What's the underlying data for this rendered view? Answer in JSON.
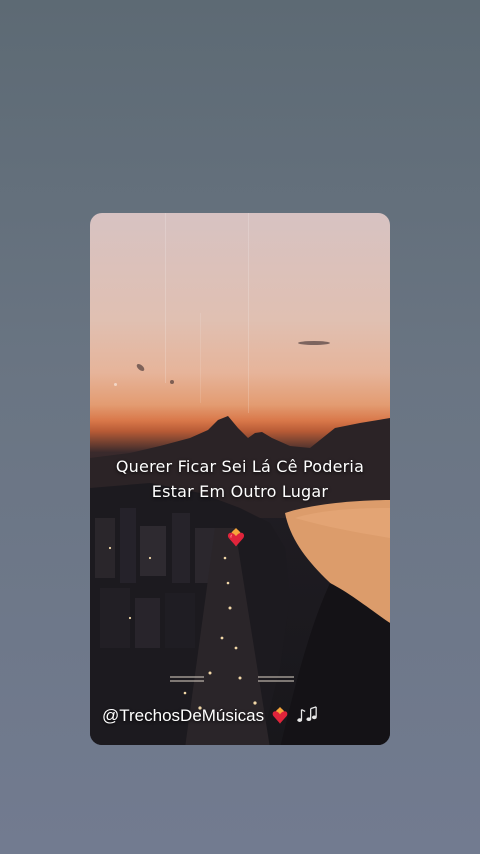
{
  "story": {
    "lyrics": {
      "line1": "Querer Ficar Sei Lá Cê Poderia",
      "line2": "Estar Em Outro Lugar"
    },
    "handle": "@TrechosDeMúsicas",
    "icons": {
      "center": "heart-on-fire-icon",
      "handle_heart": "heart-on-fire-icon",
      "notes": "musical-notes-icon"
    }
  },
  "colors": {
    "background_top": "#5d6a74",
    "background_bottom": "#727b90",
    "sky_top": "#d7c2c2",
    "sunset_orange": "#d9784a",
    "lagoon": "#e0a070",
    "city_dark": "#18171b"
  }
}
